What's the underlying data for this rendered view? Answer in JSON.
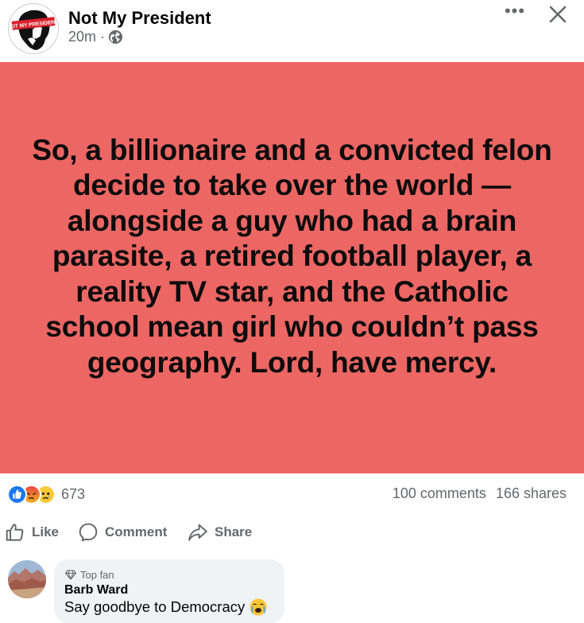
{
  "post": {
    "page_name": "Not My President",
    "avatar_text": "NOT MY PRESIDENT",
    "time": "20m",
    "separator": "·",
    "image_text": "So, a billionaire and a convicted felon decide to take over the world —alongside a guy who had a brain parasite, a retired football player, a reality TV star, and the Catholic school mean girl who couldn’t pass geography. Lord, have mercy.",
    "image_bg": "#ec6663"
  },
  "stats": {
    "reaction_count": "673",
    "reactions": [
      "like",
      "angry",
      "sad"
    ],
    "comments": "100 comments",
    "shares": "166 shares"
  },
  "actions": {
    "like": "Like",
    "comment": "Comment",
    "share": "Share"
  },
  "comment": {
    "badge": "Top fan",
    "name": "Barb Ward",
    "text": "Say goodbye to Democracy",
    "emoji": "crying-face"
  },
  "colors": {
    "secondary_text": "#65676b",
    "like_blue": "#1877f2",
    "bubble_bg": "#f0f2f5"
  }
}
